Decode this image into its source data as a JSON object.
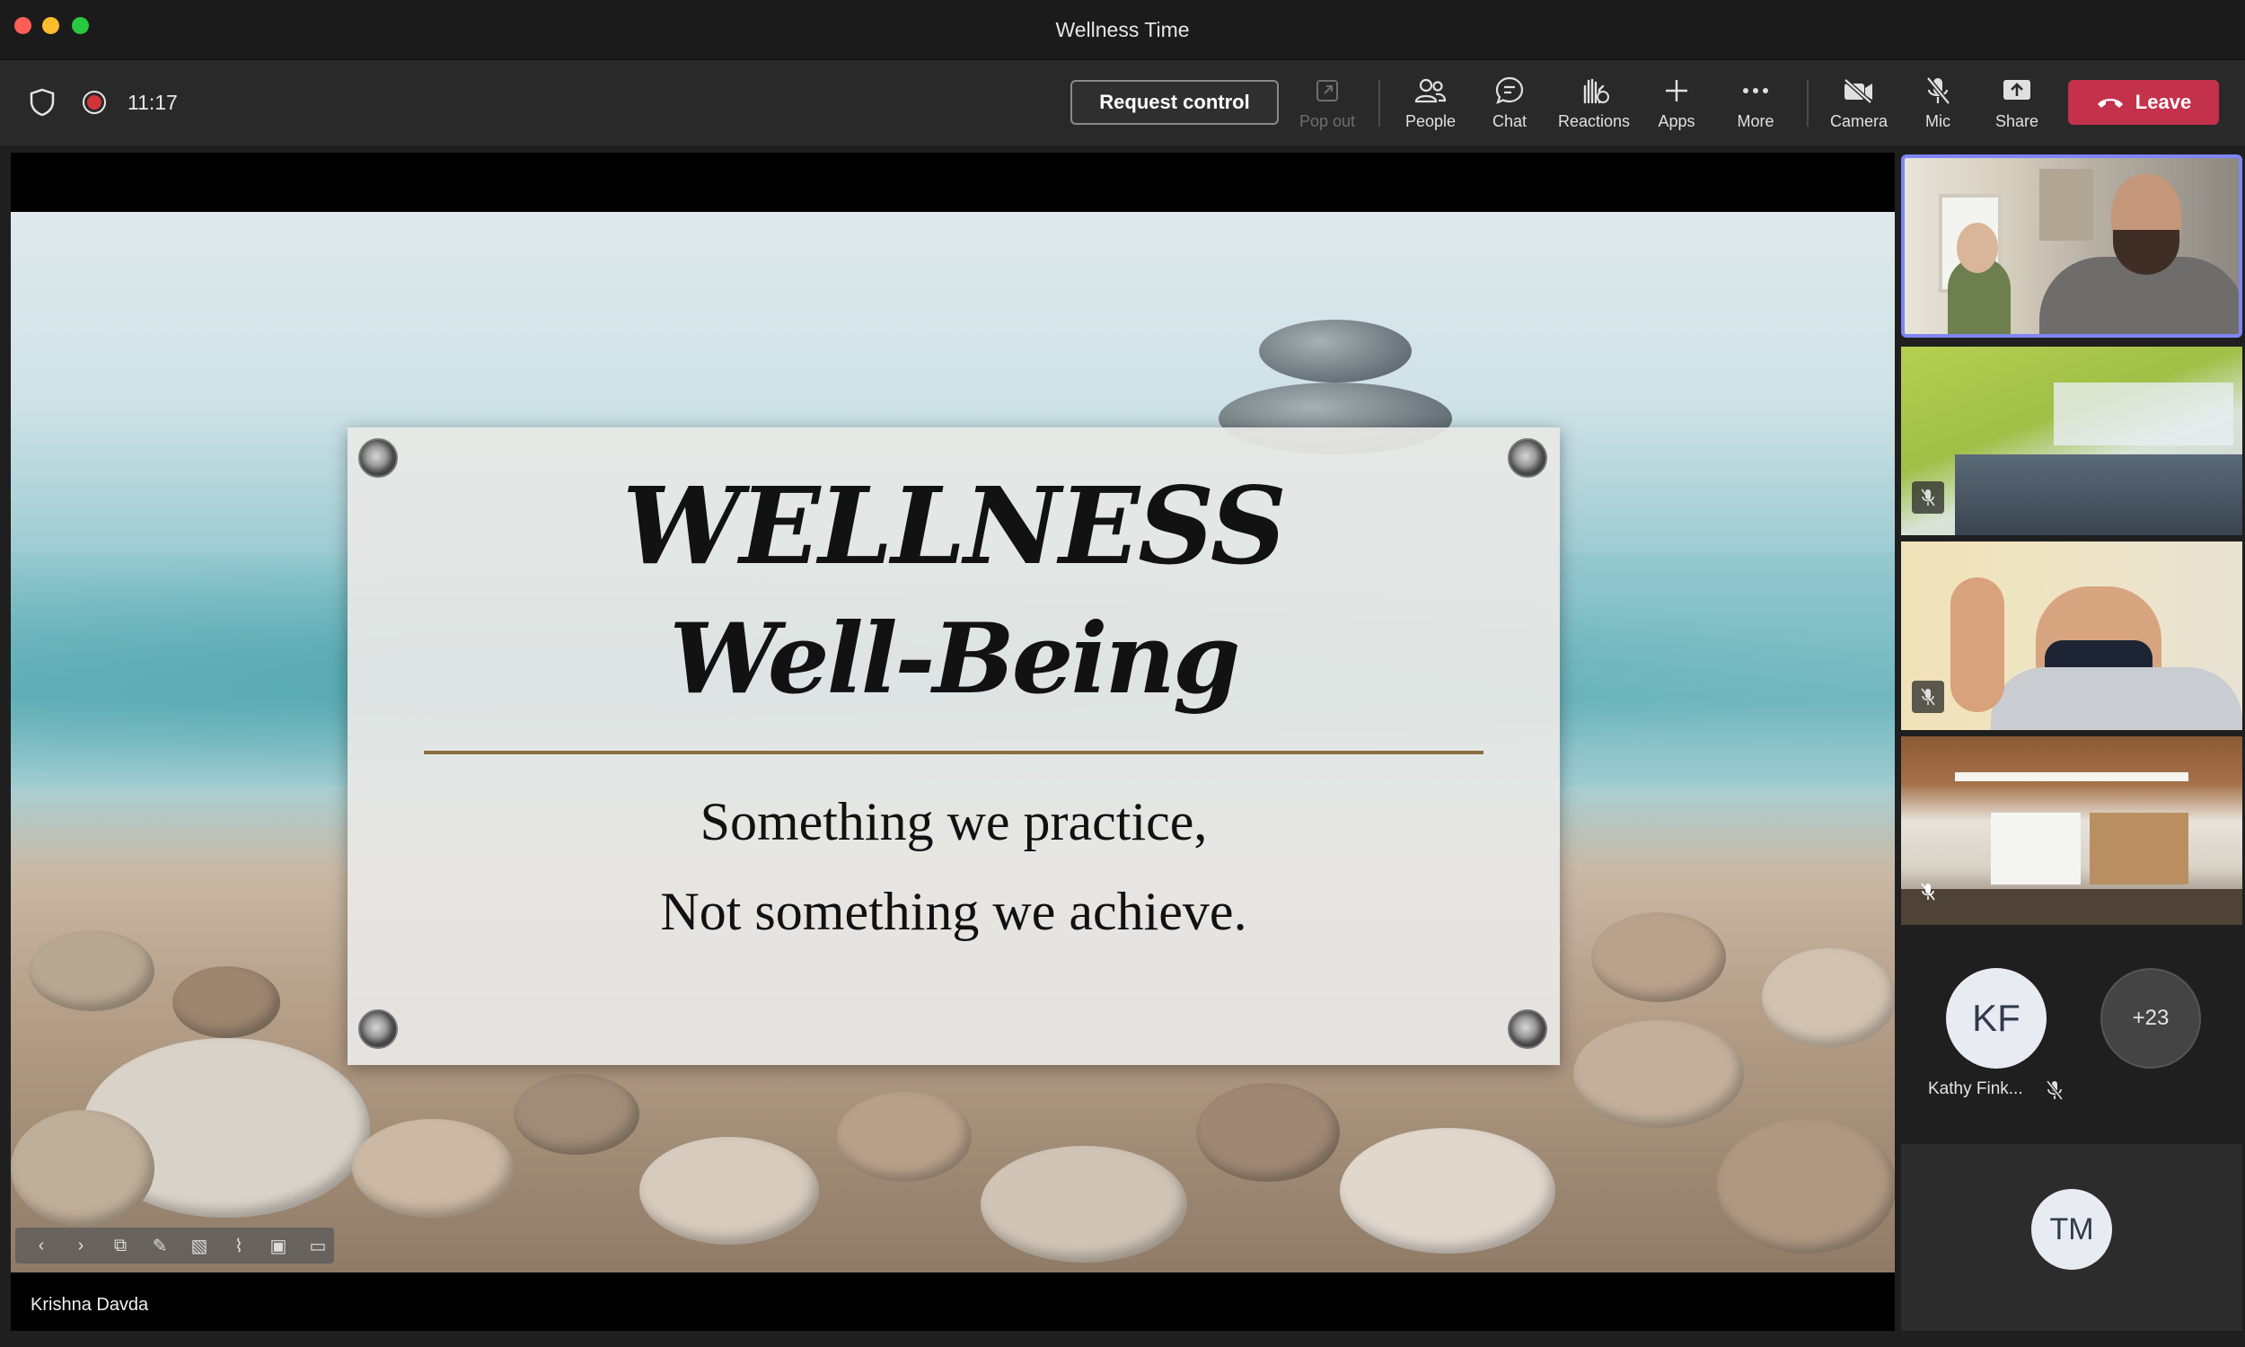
{
  "window": {
    "title": "Wellness Time"
  },
  "toolbar": {
    "timer": "11:17",
    "request_control": "Request control",
    "items": [
      {
        "label": "Pop out",
        "icon": "pop-out-icon",
        "disabled": true
      },
      {
        "label": "People",
        "icon": "people-icon"
      },
      {
        "label": "Chat",
        "icon": "chat-icon"
      },
      {
        "label": "Reactions",
        "icon": "reactions-icon"
      },
      {
        "label": "Apps",
        "icon": "apps-icon"
      },
      {
        "label": "More",
        "icon": "more-icon"
      },
      {
        "label": "Camera",
        "icon": "camera-off-icon"
      },
      {
        "label": "Mic",
        "icon": "mic-off-icon"
      },
      {
        "label": "Share",
        "icon": "share-icon"
      }
    ],
    "leave": "Leave",
    "colors": {
      "leave": "#c4314b",
      "active_tile_border": "#7f85f5"
    }
  },
  "slide": {
    "title_line1": "WELLNESS",
    "title_line2": "Well-Being",
    "subtitle_line1": "Something we practice,",
    "subtitle_line2": "Not something we achieve."
  },
  "presenter": {
    "name": "Krishna Davda"
  },
  "gallery": {
    "kf": {
      "initials": "KF",
      "name": "Kathy Fink..."
    },
    "more_count": "+23",
    "tm": {
      "initials": "TM"
    }
  }
}
